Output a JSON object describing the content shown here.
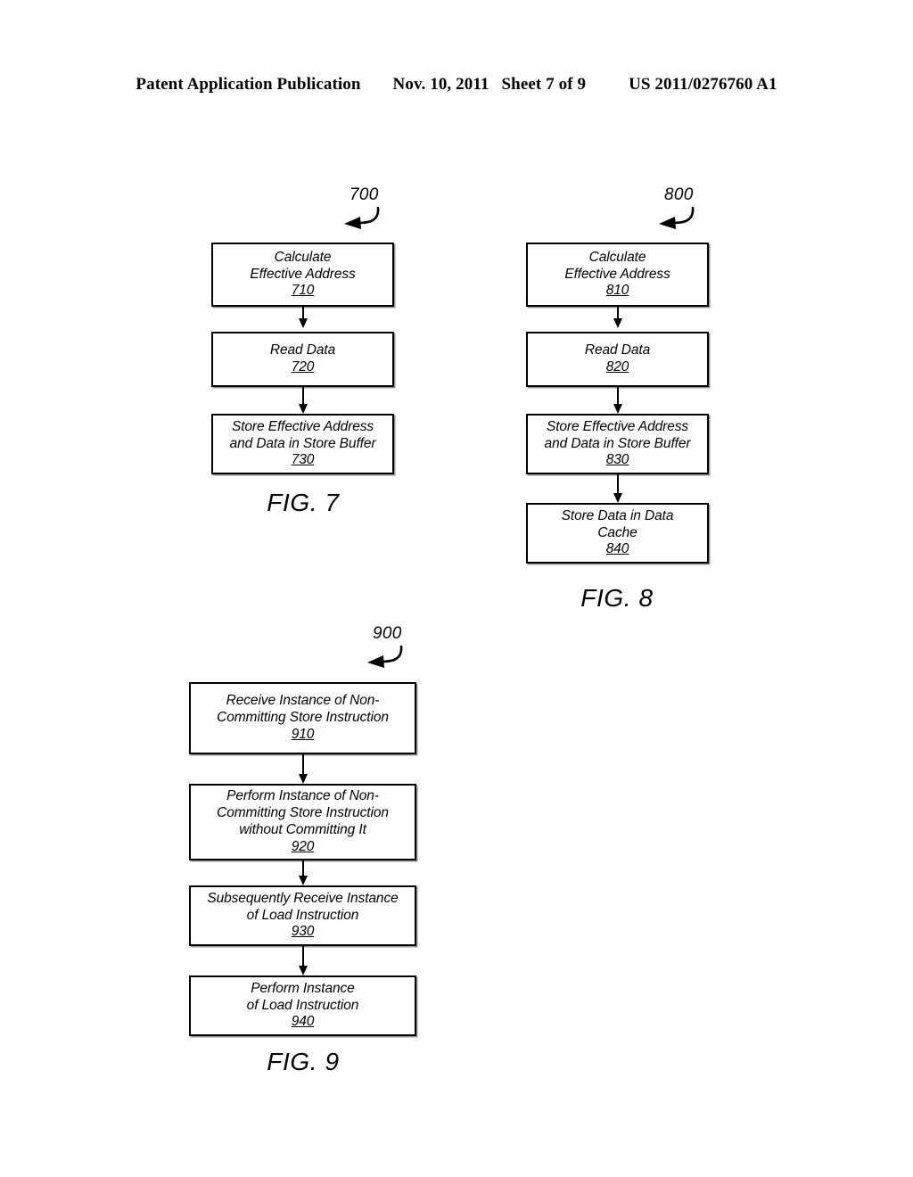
{
  "header": {
    "publication": "Patent Application Publication",
    "date": "Nov. 10, 2011",
    "sheet": "Sheet 7 of 9",
    "patent_number": "US 2011/0276760 A1"
  },
  "figures": [
    {
      "id": "fig7",
      "figure_number": "700",
      "caption": "FIG. 7",
      "steps": [
        {
          "text": "Calculate\nEffective Address",
          "ref": "710"
        },
        {
          "text": "Read Data",
          "ref": "720"
        },
        {
          "text": "Store Effective Address\nand Data in Store Buffer",
          "ref": "730"
        }
      ]
    },
    {
      "id": "fig8",
      "figure_number": "800",
      "caption": "FIG. 8",
      "steps": [
        {
          "text": "Calculate\nEffective Address",
          "ref": "810"
        },
        {
          "text": "Read Data",
          "ref": "820"
        },
        {
          "text": "Store Effective Address\nand Data in Store Buffer",
          "ref": "830"
        },
        {
          "text": "Store Data in Data\nCache",
          "ref": "840"
        }
      ]
    },
    {
      "id": "fig9",
      "figure_number": "900",
      "caption": "FIG. 9",
      "steps": [
        {
          "text": "Receive Instance of Non-\nCommitting Store Instruction",
          "ref": "910"
        },
        {
          "text": "Perform Instance of Non-\nCommitting Store Instruction\nwithout Committing It",
          "ref": "920"
        },
        {
          "text": "Subsequently Receive Instance\nof Load Instruction",
          "ref": "930"
        },
        {
          "text": "Perform Instance\nof Load Instruction",
          "ref": "940"
        }
      ]
    }
  ],
  "colors": {
    "ink": "#000000",
    "paper": "#ffffff"
  }
}
